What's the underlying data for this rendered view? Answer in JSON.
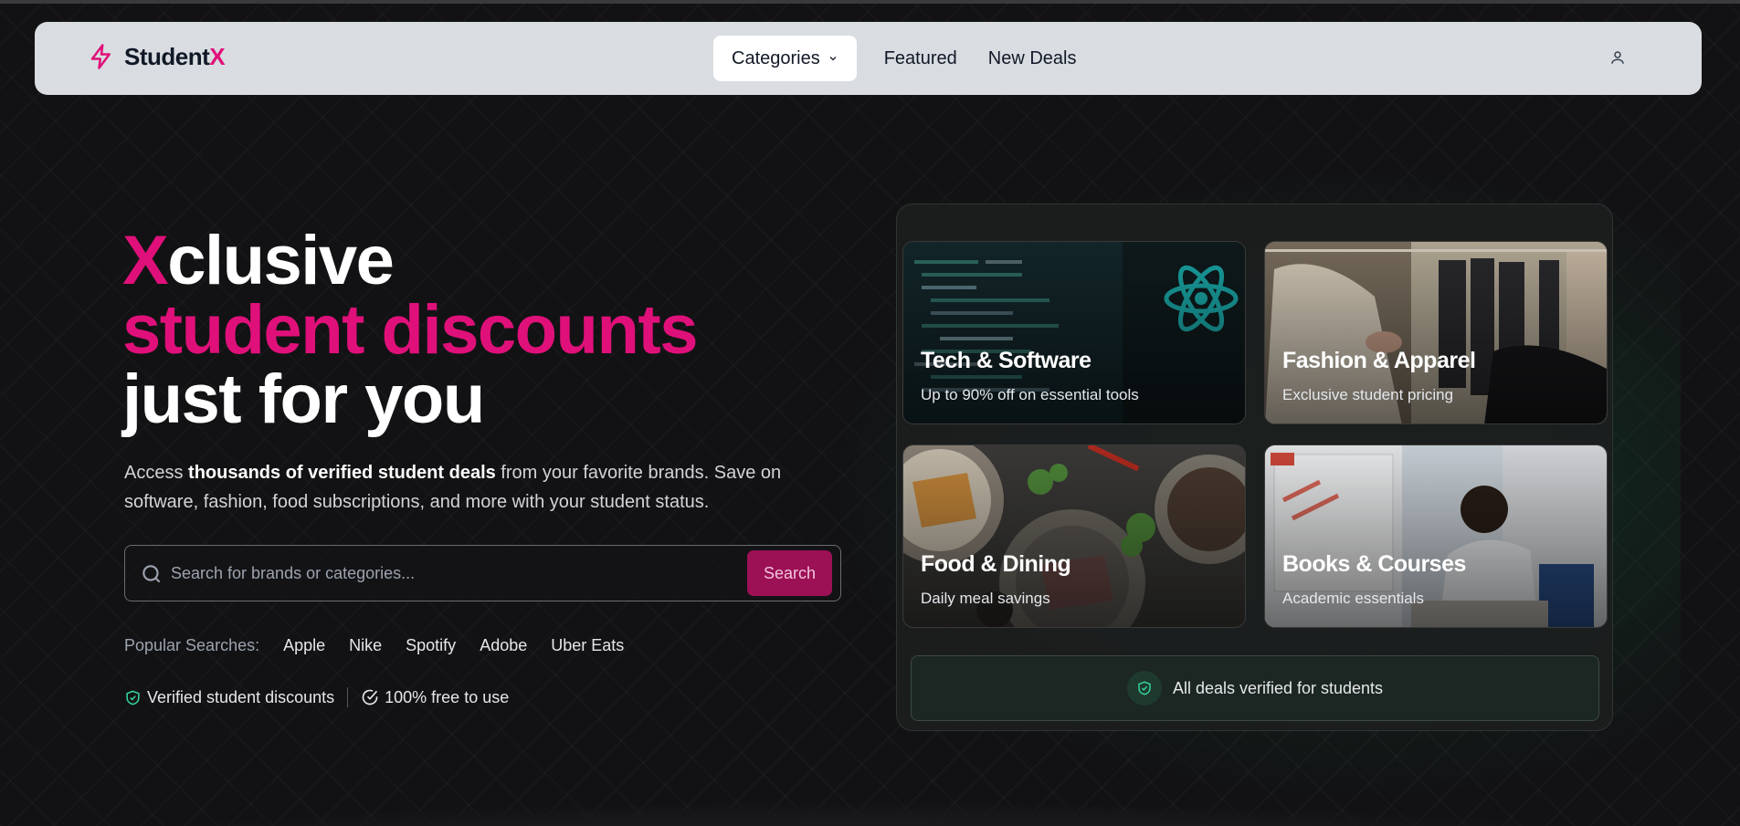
{
  "brand": {
    "name_main": "Student",
    "name_accent": "X"
  },
  "nav": {
    "categories_label": "Categories",
    "featured_label": "Featured",
    "new_deals_label": "New Deals",
    "user_icon": "user-icon"
  },
  "hero": {
    "title_x": "X",
    "title_rest": "clusive",
    "title_line2": "student discounts",
    "title_line3": "just for you",
    "desc_prefix": "Access ",
    "desc_bold": "thousands of verified student deals",
    "desc_suffix": " from your favorite brands. Save on software, fashion, food subscriptions, and more with your student status."
  },
  "search": {
    "placeholder": "Search for brands or categories...",
    "button_label": "Search"
  },
  "popular": {
    "label": "Popular Searches:",
    "items": [
      "Apple",
      "Nike",
      "Spotify",
      "Adobe",
      "Uber Eats"
    ]
  },
  "trust": {
    "item1": "Verified student discounts",
    "item2": "100% free to use"
  },
  "categories": [
    {
      "title": "Tech & Software",
      "subtitle": "Up to 90% off on essential tools"
    },
    {
      "title": "Fashion & Apparel",
      "subtitle": "Exclusive student pricing"
    },
    {
      "title": "Food & Dining",
      "subtitle": "Daily meal savings"
    },
    {
      "title": "Books & Courses",
      "subtitle": "Academic essentials"
    }
  ],
  "verified_banner": "All deals verified for students",
  "colors": {
    "accent": "#e0107a",
    "search_button": "#9c1056",
    "navbar": "#d9dde1",
    "background": "#121214",
    "verified_green": "#34d399"
  }
}
